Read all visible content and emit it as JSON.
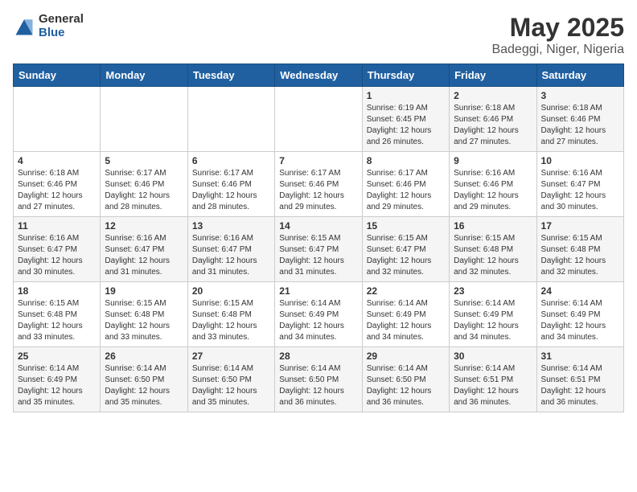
{
  "header": {
    "logo_general": "General",
    "logo_blue": "Blue",
    "title": "May 2025",
    "subtitle": "Badeggi, Niger, Nigeria"
  },
  "days_of_week": [
    "Sunday",
    "Monday",
    "Tuesday",
    "Wednesday",
    "Thursday",
    "Friday",
    "Saturday"
  ],
  "weeks": [
    [
      {
        "day": "",
        "info": ""
      },
      {
        "day": "",
        "info": ""
      },
      {
        "day": "",
        "info": ""
      },
      {
        "day": "",
        "info": ""
      },
      {
        "day": "1",
        "info": "Sunrise: 6:19 AM\nSunset: 6:45 PM\nDaylight: 12 hours and 26 minutes."
      },
      {
        "day": "2",
        "info": "Sunrise: 6:18 AM\nSunset: 6:46 PM\nDaylight: 12 hours and 27 minutes."
      },
      {
        "day": "3",
        "info": "Sunrise: 6:18 AM\nSunset: 6:46 PM\nDaylight: 12 hours and 27 minutes."
      }
    ],
    [
      {
        "day": "4",
        "info": "Sunrise: 6:18 AM\nSunset: 6:46 PM\nDaylight: 12 hours and 27 minutes."
      },
      {
        "day": "5",
        "info": "Sunrise: 6:17 AM\nSunset: 6:46 PM\nDaylight: 12 hours and 28 minutes."
      },
      {
        "day": "6",
        "info": "Sunrise: 6:17 AM\nSunset: 6:46 PM\nDaylight: 12 hours and 28 minutes."
      },
      {
        "day": "7",
        "info": "Sunrise: 6:17 AM\nSunset: 6:46 PM\nDaylight: 12 hours and 29 minutes."
      },
      {
        "day": "8",
        "info": "Sunrise: 6:17 AM\nSunset: 6:46 PM\nDaylight: 12 hours and 29 minutes."
      },
      {
        "day": "9",
        "info": "Sunrise: 6:16 AM\nSunset: 6:46 PM\nDaylight: 12 hours and 29 minutes."
      },
      {
        "day": "10",
        "info": "Sunrise: 6:16 AM\nSunset: 6:47 PM\nDaylight: 12 hours and 30 minutes."
      }
    ],
    [
      {
        "day": "11",
        "info": "Sunrise: 6:16 AM\nSunset: 6:47 PM\nDaylight: 12 hours and 30 minutes."
      },
      {
        "day": "12",
        "info": "Sunrise: 6:16 AM\nSunset: 6:47 PM\nDaylight: 12 hours and 31 minutes."
      },
      {
        "day": "13",
        "info": "Sunrise: 6:16 AM\nSunset: 6:47 PM\nDaylight: 12 hours and 31 minutes."
      },
      {
        "day": "14",
        "info": "Sunrise: 6:15 AM\nSunset: 6:47 PM\nDaylight: 12 hours and 31 minutes."
      },
      {
        "day": "15",
        "info": "Sunrise: 6:15 AM\nSunset: 6:47 PM\nDaylight: 12 hours and 32 minutes."
      },
      {
        "day": "16",
        "info": "Sunrise: 6:15 AM\nSunset: 6:48 PM\nDaylight: 12 hours and 32 minutes."
      },
      {
        "day": "17",
        "info": "Sunrise: 6:15 AM\nSunset: 6:48 PM\nDaylight: 12 hours and 32 minutes."
      }
    ],
    [
      {
        "day": "18",
        "info": "Sunrise: 6:15 AM\nSunset: 6:48 PM\nDaylight: 12 hours and 33 minutes."
      },
      {
        "day": "19",
        "info": "Sunrise: 6:15 AM\nSunset: 6:48 PM\nDaylight: 12 hours and 33 minutes."
      },
      {
        "day": "20",
        "info": "Sunrise: 6:15 AM\nSunset: 6:48 PM\nDaylight: 12 hours and 33 minutes."
      },
      {
        "day": "21",
        "info": "Sunrise: 6:14 AM\nSunset: 6:49 PM\nDaylight: 12 hours and 34 minutes."
      },
      {
        "day": "22",
        "info": "Sunrise: 6:14 AM\nSunset: 6:49 PM\nDaylight: 12 hours and 34 minutes."
      },
      {
        "day": "23",
        "info": "Sunrise: 6:14 AM\nSunset: 6:49 PM\nDaylight: 12 hours and 34 minutes."
      },
      {
        "day": "24",
        "info": "Sunrise: 6:14 AM\nSunset: 6:49 PM\nDaylight: 12 hours and 34 minutes."
      }
    ],
    [
      {
        "day": "25",
        "info": "Sunrise: 6:14 AM\nSunset: 6:49 PM\nDaylight: 12 hours and 35 minutes."
      },
      {
        "day": "26",
        "info": "Sunrise: 6:14 AM\nSunset: 6:50 PM\nDaylight: 12 hours and 35 minutes."
      },
      {
        "day": "27",
        "info": "Sunrise: 6:14 AM\nSunset: 6:50 PM\nDaylight: 12 hours and 35 minutes."
      },
      {
        "day": "28",
        "info": "Sunrise: 6:14 AM\nSunset: 6:50 PM\nDaylight: 12 hours and 36 minutes."
      },
      {
        "day": "29",
        "info": "Sunrise: 6:14 AM\nSunset: 6:50 PM\nDaylight: 12 hours and 36 minutes."
      },
      {
        "day": "30",
        "info": "Sunrise: 6:14 AM\nSunset: 6:51 PM\nDaylight: 12 hours and 36 minutes."
      },
      {
        "day": "31",
        "info": "Sunrise: 6:14 AM\nSunset: 6:51 PM\nDaylight: 12 hours and 36 minutes."
      }
    ]
  ]
}
